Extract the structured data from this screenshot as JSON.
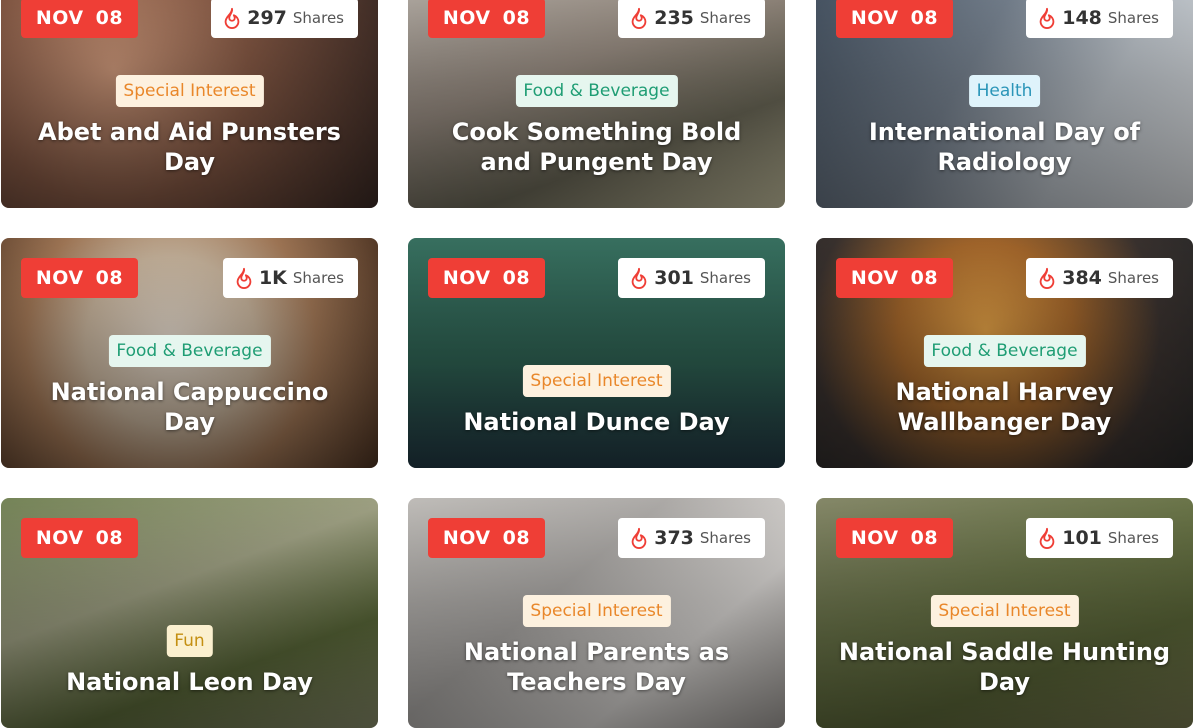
{
  "cards": [
    {
      "month": "NOV",
      "day": "08",
      "shares": "297",
      "shares_label": "Shares",
      "category": "Special Interest",
      "title": "Abet and Aid Punsters Day"
    },
    {
      "month": "NOV",
      "day": "08",
      "shares": "235",
      "shares_label": "Shares",
      "category": "Food & Beverage",
      "title": "Cook Something Bold and Pungent Day"
    },
    {
      "month": "NOV",
      "day": "08",
      "shares": "148",
      "shares_label": "Shares",
      "category": "Health",
      "title": "International Day of Radiology"
    },
    {
      "month": "NOV",
      "day": "08",
      "shares": "1K",
      "shares_label": "Shares",
      "category": "Food & Beverage",
      "title": "National Cappuccino Day"
    },
    {
      "month": "NOV",
      "day": "08",
      "shares": "301",
      "shares_label": "Shares",
      "category": "Special Interest",
      "title": "National Dunce Day"
    },
    {
      "month": "NOV",
      "day": "08",
      "shares": "384",
      "shares_label": "Shares",
      "category": "Food & Beverage",
      "title": "National Harvey Wallbanger Day"
    },
    {
      "month": "NOV",
      "day": "08",
      "shares": "",
      "shares_label": "",
      "category": "Fun",
      "title": "National Leon Day"
    },
    {
      "month": "NOV",
      "day": "08",
      "shares": "373",
      "shares_label": "Shares",
      "category": "Special Interest",
      "title": "National Parents as Teachers Day"
    },
    {
      "month": "NOV",
      "day": "08",
      "shares": "101",
      "shares_label": "Shares",
      "category": "Special Interest",
      "title": "National Saddle Hunting Day"
    }
  ],
  "icons": {
    "shares": "flame-icon"
  },
  "colors": {
    "date_badge": "#ef3e36",
    "special_interest": "#e9872a",
    "food_beverage": "#1f9d74",
    "health": "#2a95b8",
    "fun": "#c48f12"
  }
}
